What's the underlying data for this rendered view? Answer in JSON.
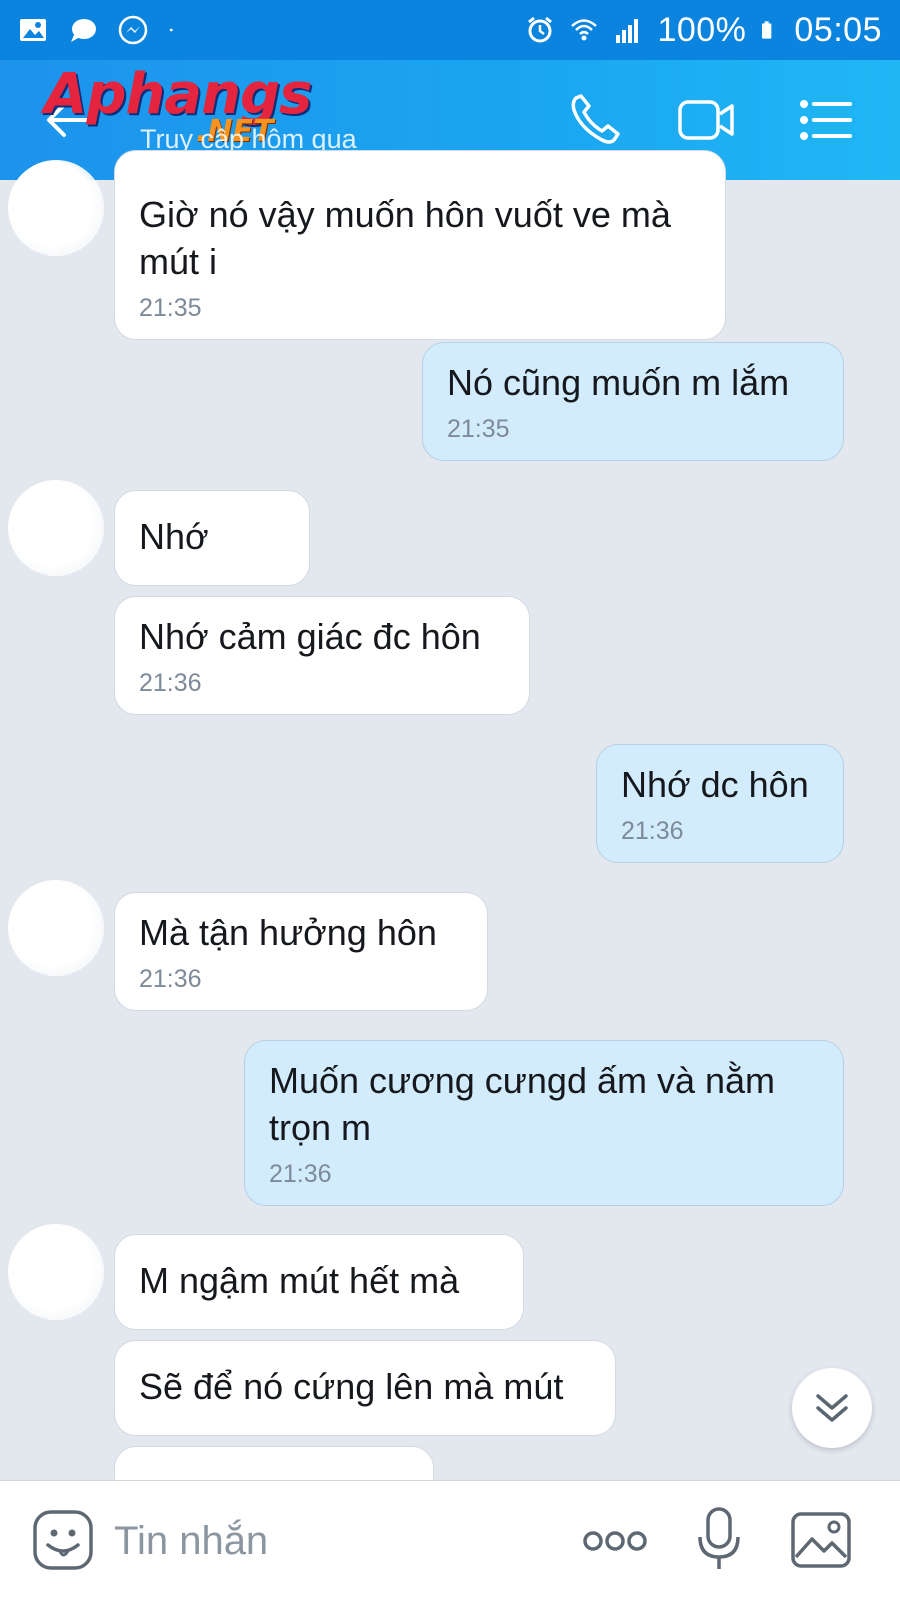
{
  "status_bar": {
    "battery": "100%",
    "time": "05:05"
  },
  "header": {
    "watermark_main": "Aphangs",
    "watermark_sub": ".NET",
    "subtitle": "Truy cập hôm qua"
  },
  "messages": [
    {
      "side": "in",
      "text": "Giờ nó vậy muốn hôn vuốt ve mà mút i",
      "time": "21:35"
    },
    {
      "side": "out",
      "text": "Nó cũng muốn m lắm",
      "time": "21:35"
    },
    {
      "side": "in",
      "text": "Nhớ",
      "time": ""
    },
    {
      "side": "in",
      "text": "Nhớ cảm giác đc hôn",
      "time": "21:36"
    },
    {
      "side": "out",
      "text": "Nhớ dc hôn",
      "time": "21:36"
    },
    {
      "side": "in",
      "text": "Mà tận hưởng hôn",
      "time": "21:36"
    },
    {
      "side": "out",
      "text": "Muốn cương cưngd ấm và nằm trọn m",
      "time": "21:36"
    },
    {
      "side": "in",
      "text": "M ngậm mút hết mà",
      "time": ""
    },
    {
      "side": "in",
      "text": "Sẽ để nó cứng lên mà mút",
      "time": ""
    }
  ],
  "input_bar": {
    "placeholder": "Tin nhắn"
  },
  "colors": {
    "header": "#1aa6f1",
    "status_bar": "#0a84de",
    "incoming_bubble": "#ffffff",
    "outgoing_bubble": "#d3ecfd",
    "chat_background": "#e3e8ef"
  },
  "icons": {
    "status_left": [
      "gallery-icon",
      "chat-bubble-icon",
      "messenger-icon",
      "dot-icon"
    ],
    "status_right": [
      "alarm-icon",
      "wifi-icon",
      "signal-icon",
      "battery-icon"
    ],
    "header": [
      "back-arrow-icon",
      "phone-icon",
      "video-camera-icon",
      "menu-list-icon"
    ],
    "input_bar": [
      "sticker-icon",
      "more-dots-icon",
      "microphone-icon",
      "image-icon"
    ],
    "chat": [
      "double-chevron-down-icon"
    ]
  }
}
